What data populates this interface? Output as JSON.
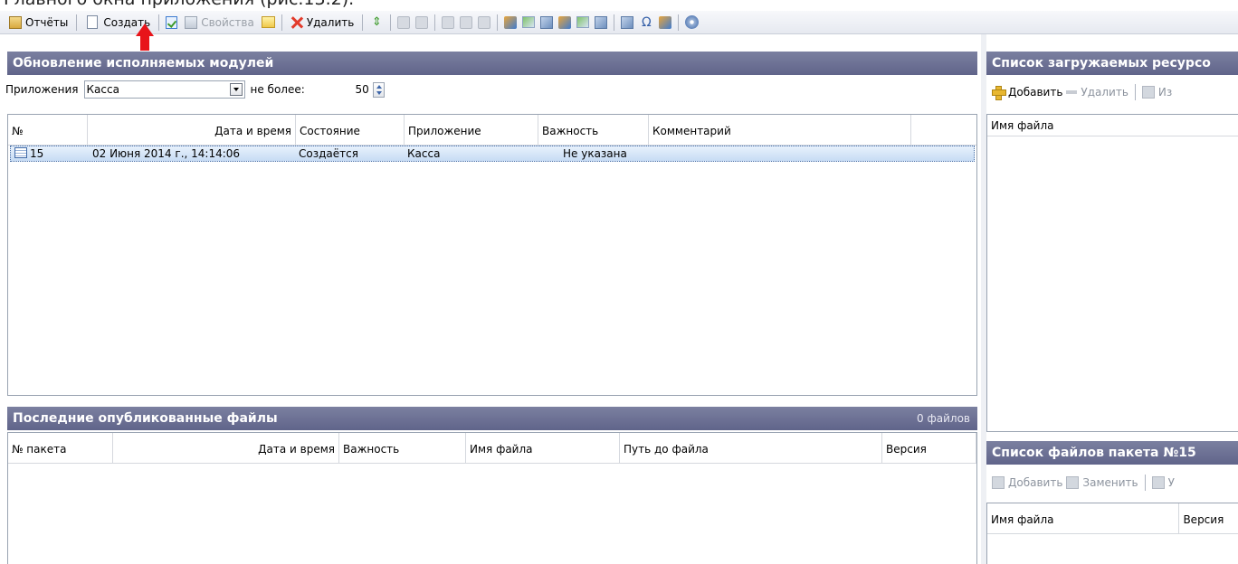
{
  "caption": "Главного окна приложения (рис.13.2).",
  "toolbar": {
    "reports_label": "Отчёты",
    "create_label": "Создать",
    "properties_label": "Свойства",
    "delete_label": "Удалить"
  },
  "modules_panel": {
    "title": "Обновление исполняемых модулей",
    "filter": {
      "app_label": "Приложения",
      "app_value": "Касса",
      "max_label": "не более:",
      "max_value": "50"
    },
    "columns": [
      "№",
      "Дата и время",
      "Состояние",
      "Приложение",
      "Важность",
      "Комментарий"
    ],
    "rows": [
      {
        "num": "15",
        "datetime": "02 Июня 2014 г., 14:14:06",
        "state": "Создаётся",
        "app": "Касса",
        "importance": "Не указана",
        "comment": ""
      }
    ]
  },
  "published_panel": {
    "title": "Последние опубликованные файлы",
    "count": "0 файлов",
    "columns": [
      "№ пакета",
      "Дата и время",
      "Важность",
      "Имя файла",
      "Путь до файла",
      "Версия"
    ]
  },
  "resources_panel": {
    "title": "Список загружаемых ресурсо",
    "add_label": "Добавить",
    "delete_label": "Удалить",
    "third_label": "Из",
    "column": "Имя файла"
  },
  "package_panel": {
    "title": "Список файлов пакета №15",
    "add_label": "Добавить",
    "replace_label": "Заменить",
    "third_label": "У",
    "columns": [
      "Имя файла",
      "Версия"
    ]
  }
}
